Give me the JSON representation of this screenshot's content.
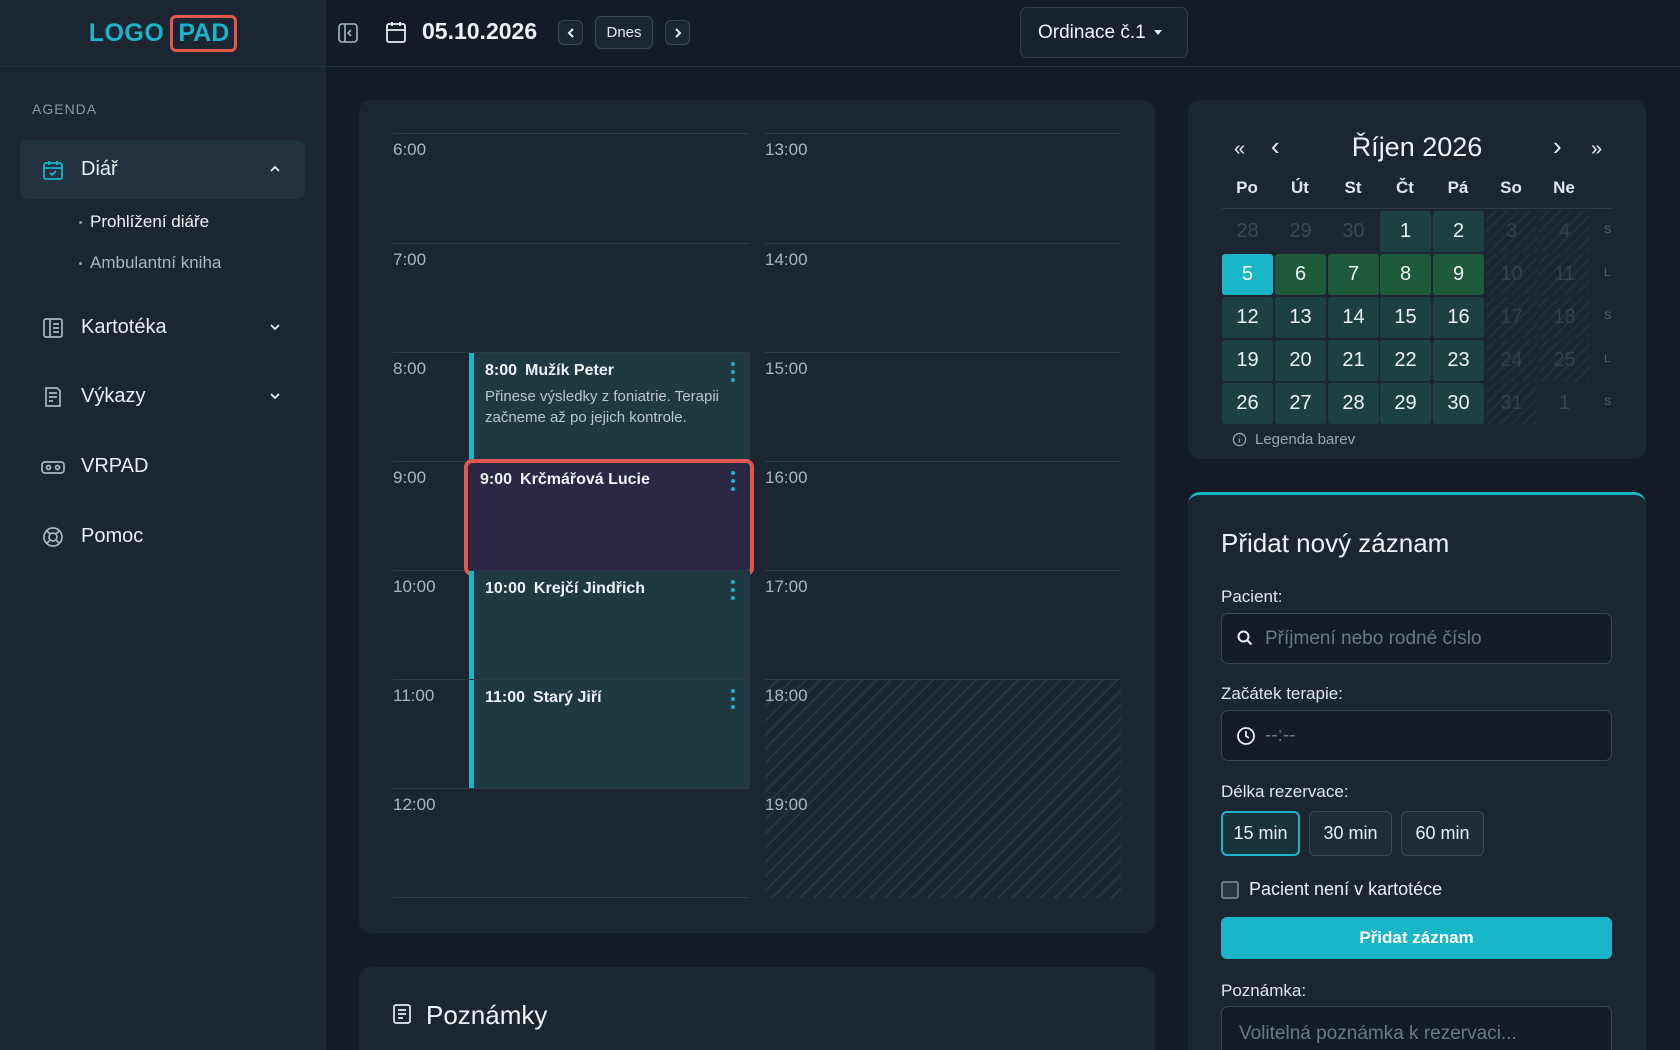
{
  "logo": {
    "part1": "LOGO",
    "part2": "PAD"
  },
  "sidebar": {
    "section_label": "AGENDA",
    "items": [
      {
        "label": "Diář",
        "icon": "calendar-check-icon"
      },
      {
        "label": "Kartotéka",
        "icon": "card-index-icon"
      },
      {
        "label": "Výkazy",
        "icon": "report-icon"
      },
      {
        "label": "VRPAD",
        "icon": "vr-headset-icon"
      },
      {
        "label": "Pomoc",
        "icon": "lifebuoy-icon"
      }
    ],
    "sub_items": [
      {
        "label": "Prohlížení diáře"
      },
      {
        "label": "Ambulantní kniha"
      }
    ]
  },
  "topbar": {
    "date": "05.10.2026",
    "today_label": "Dnes",
    "ordinace": "Ordinace č.1"
  },
  "schedule": {
    "left_times": [
      "6:00",
      "7:00",
      "8:00",
      "9:00",
      "10:00",
      "11:00",
      "12:00"
    ],
    "right_times": [
      "13:00",
      "14:00",
      "15:00",
      "16:00",
      "17:00",
      "18:00",
      "19:00"
    ],
    "appointments": [
      {
        "time": "8:00",
        "name": "Mužík Peter",
        "note": "Přinese výsledky z foniatrie. Terapii začneme až po jejich kontrole."
      },
      {
        "time": "9:00",
        "name": "Krčmářová Lucie",
        "note": ""
      },
      {
        "time": "10:00",
        "name": "Krejčí Jindřich",
        "note": ""
      },
      {
        "time": "11:00",
        "name": "Starý Jiří",
        "note": ""
      }
    ]
  },
  "notes": {
    "title": "Poznámky"
  },
  "calendar": {
    "title": "Říjen 2026",
    "nav": {
      "first": "«",
      "prev": "‹",
      "next": "›",
      "last": "»"
    },
    "dow": [
      "Po",
      "Út",
      "St",
      "Čt",
      "Pá",
      "So",
      "Ne"
    ],
    "weeks": [
      [
        "28",
        "29",
        "30",
        "1",
        "2",
        "3",
        "4"
      ],
      [
        "5",
        "6",
        "7",
        "8",
        "9",
        "10",
        "11"
      ],
      [
        "12",
        "13",
        "14",
        "15",
        "16",
        "17",
        "18"
      ],
      [
        "19",
        "20",
        "21",
        "22",
        "23",
        "24",
        "25"
      ],
      [
        "26",
        "27",
        "28",
        "29",
        "30",
        "31",
        "1"
      ]
    ],
    "week_marks": [
      "S",
      "L",
      "S",
      "L",
      "S"
    ],
    "legend": "Legenda barev"
  },
  "add_record": {
    "title": "Přidat nový záznam",
    "patient_label": "Pacient:",
    "patient_placeholder": "Příjmení nebo rodné číslo",
    "start_label": "Začátek terapie:",
    "start_placeholder": "--:--",
    "duration_label": "Délka rezervace:",
    "durations": [
      "15 min",
      "30 min",
      "60 min"
    ],
    "not_in_index_label": "Pacient není v kartotéce",
    "submit_label": "Přidat záznam",
    "note_label": "Poznámka:",
    "note_placeholder": "Volitelná poznámka k rezervaci..."
  },
  "colors": {
    "accent": "#19b6c8",
    "highlight": "#e0574c",
    "booked_day": "#1e5a3c",
    "available_day": "#1d4040",
    "selected_appointment": "#2b2745"
  }
}
